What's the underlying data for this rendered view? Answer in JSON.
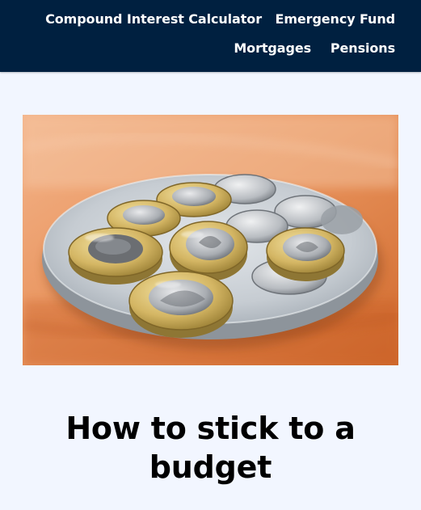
{
  "nav": {
    "items": [
      {
        "label": "Compound Interest Calculator"
      },
      {
        "label": "Emergency Fund"
      },
      {
        "label": "Mortgages"
      },
      {
        "label": "Pensions"
      }
    ]
  },
  "hero": {
    "image_name": "coins-on-metal-plate"
  },
  "article": {
    "title_line_1": "How to stick to a",
    "title_line_2": "budget"
  },
  "colors": {
    "nav_background": "#002040",
    "page_background": "#f2f6ff",
    "nav_text": "#ffffff",
    "title_text": "#000000"
  }
}
